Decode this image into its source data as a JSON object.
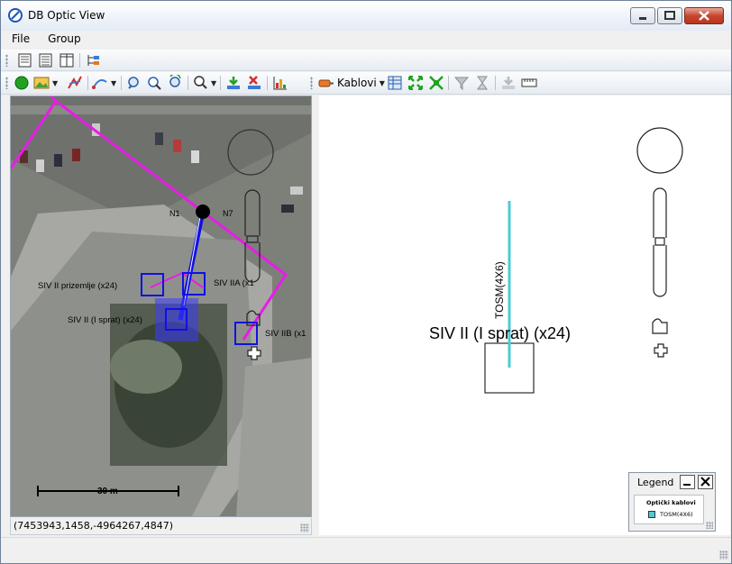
{
  "window": {
    "title": "DB Optic View"
  },
  "menu": {
    "items": [
      "File",
      "Group"
    ]
  },
  "toolbar2": {
    "cables_dropdown": "Kablovi"
  },
  "map": {
    "node_labels": [
      "N1",
      "N7"
    ],
    "box_labels": [
      "SIV II prizemlje (x24)",
      "SIV II (I sprat) (x24)",
      "SIV IIA (x1",
      "SIV IIB (x1"
    ],
    "scale_label": "30 m",
    "coordinates": "(7453943,1458,-4964267,4847)"
  },
  "diagram": {
    "node_title": "SIV II (I sprat) (x24)",
    "cable_label": "TOSM(4X6)"
  },
  "legend": {
    "title": "Legend",
    "group": "Optički kablovi",
    "entries": [
      {
        "label": "TOSM(4X6)",
        "color": "#4ccbd3"
      }
    ]
  },
  "colors": {
    "route": "#e61ee6",
    "box": "#1010e6",
    "selected_box": "#3c3cff",
    "cable": "#4ccbd3"
  }
}
